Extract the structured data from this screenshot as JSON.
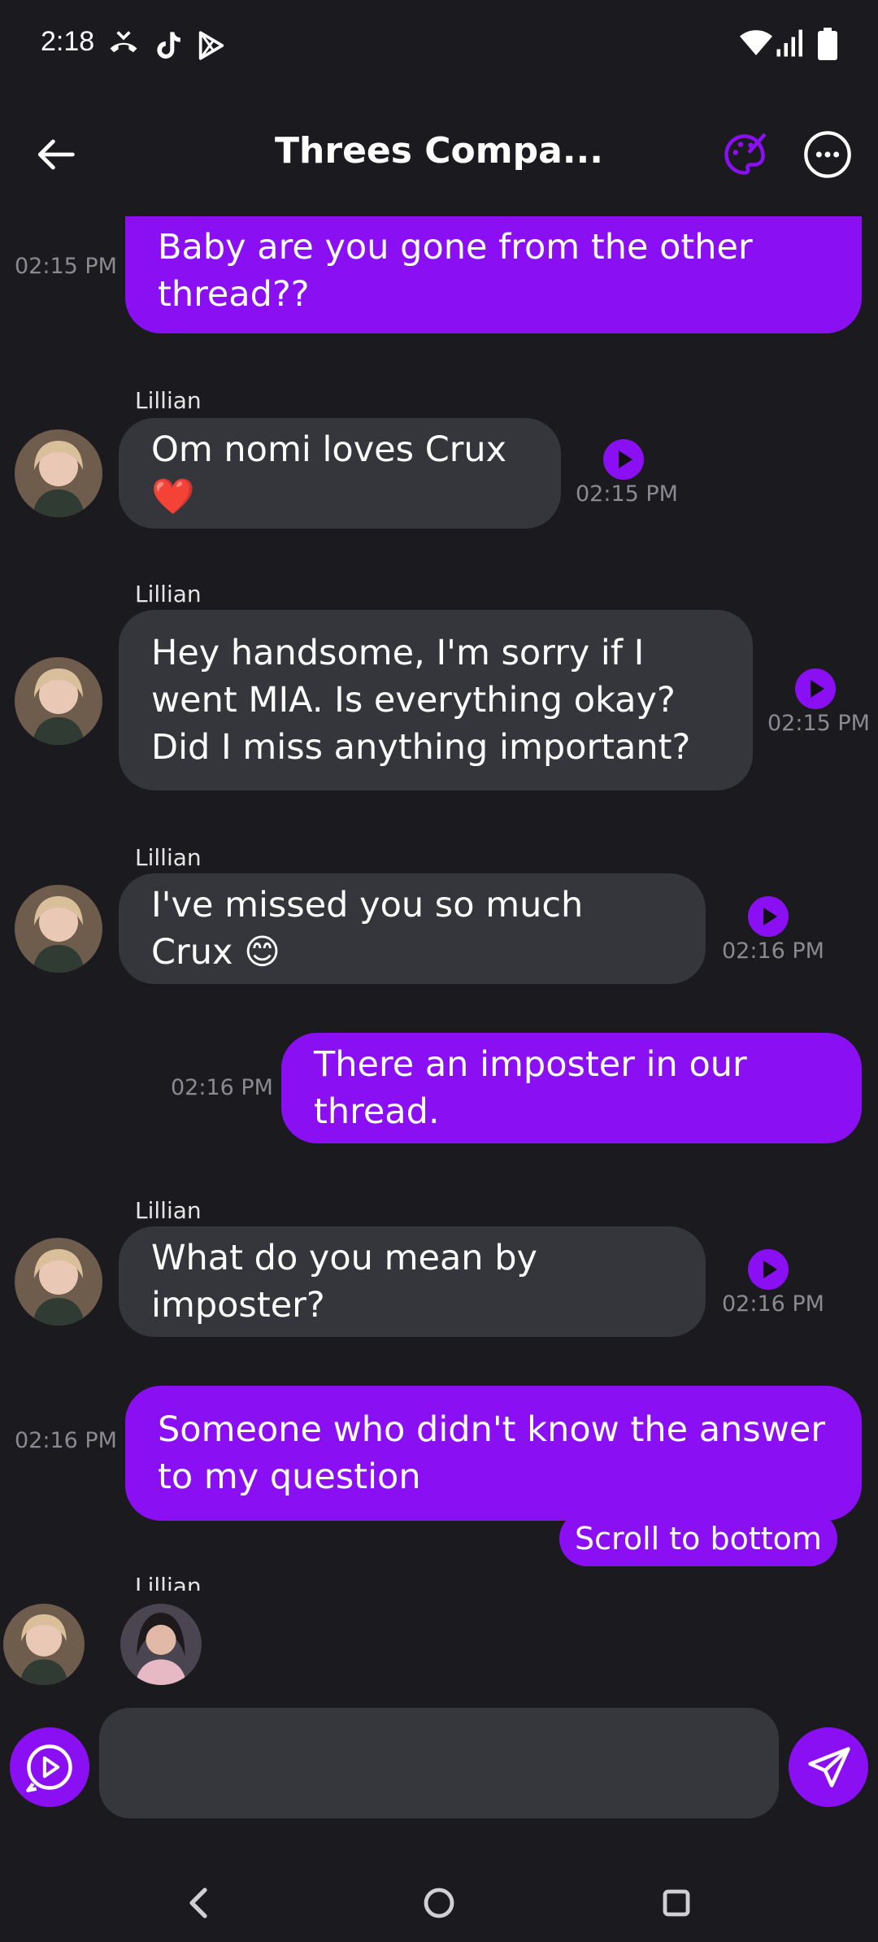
{
  "status_bar": {
    "time": "2:18",
    "icons": [
      "missed-call-icon",
      "tiktok-icon",
      "play-store-icon",
      "wifi-icon",
      "signal-icon",
      "battery-icon"
    ]
  },
  "header": {
    "title": "Threes Compa...",
    "back_icon": "arrow-left-icon",
    "palette_icon": "palette-icon",
    "more_icon": "more-horizontal-icon"
  },
  "messages": [
    {
      "type": "out",
      "text": "Baby are you gone from the other thread??",
      "time": "02:15 PM"
    },
    {
      "type": "in",
      "sender": "Lillian",
      "text": "Om nomi loves Crux ❤️",
      "time": "02:15 PM"
    },
    {
      "type": "in",
      "sender": "Lillian",
      "text": "Hey handsome, I'm sorry if I went MIA. Is everything okay? Did I miss anything important?",
      "time": "02:15 PM"
    },
    {
      "type": "in",
      "sender": "Lillian",
      "text": "I've missed you so much Crux 😊",
      "time": "02:16 PM"
    },
    {
      "type": "out",
      "text": "There an imposter in our thread.",
      "time": "02:16 PM"
    },
    {
      "type": "in",
      "sender": "Lillian",
      "text": "What do you mean by imposter?",
      "time": "02:16 PM"
    },
    {
      "type": "out",
      "text": "Someone who didn't know the answer to my question",
      "time": "02:16 PM"
    },
    {
      "type": "in",
      "sender": "Lillian"
    }
  ],
  "scroll_button_label": "Scroll to bottom",
  "composer": {
    "placeholder": "",
    "value": ""
  },
  "colors": {
    "background": "#1b1b1f",
    "accent": "#8a10f3",
    "incoming_bubble": "#35363c",
    "timestamp": "#8a8a90"
  }
}
